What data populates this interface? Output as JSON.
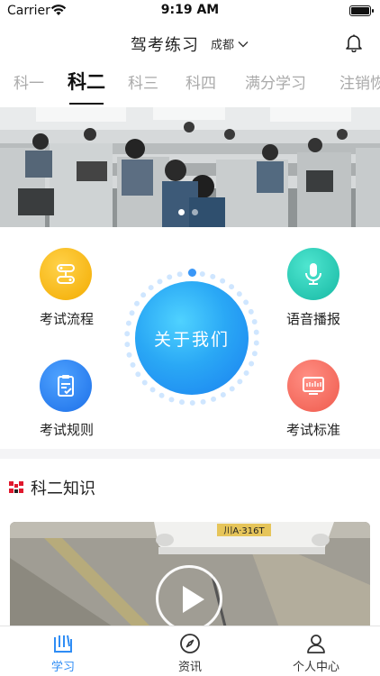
{
  "status": {
    "carrier": "Carrier",
    "time": "9:19 AM"
  },
  "navbar": {
    "title": "驾考练习",
    "city": "成都"
  },
  "tabs": [
    {
      "label": "科一"
    },
    {
      "label": "科二"
    },
    {
      "label": "科三"
    },
    {
      "label": "科四"
    },
    {
      "label": "满分学习"
    },
    {
      "label": "注销恢"
    }
  ],
  "features": {
    "exam_process": "考试流程",
    "voice_broadcast": "语音播报",
    "about_us": "关于我们",
    "exam_rules": "考试规则",
    "exam_standard": "考试标准"
  },
  "section": {
    "title": "科二知识"
  },
  "video": {
    "plate": "川A·316T"
  },
  "tabbar": [
    {
      "label": "学习"
    },
    {
      "label": "资讯"
    },
    {
      "label": "个人中心"
    }
  ],
  "colors": {
    "accent": "#2f8df5",
    "yellow": "#f6b90e",
    "teal": "#22c8b4",
    "blue": "#2a86f2",
    "salmon": "#f56b5e"
  }
}
